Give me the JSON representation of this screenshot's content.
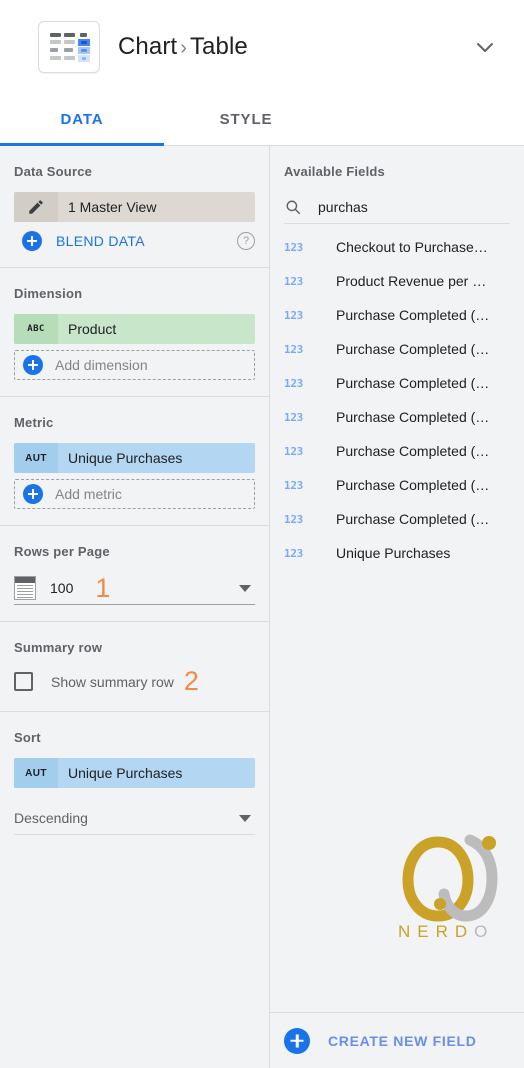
{
  "header": {
    "icon": "table-chart-icon",
    "title_prefix": "Chart",
    "separator": "›",
    "title_value": "Table",
    "collapse_icon": "chevron-down-icon"
  },
  "tabs": [
    {
      "label": "DATA",
      "active": true
    },
    {
      "label": "STYLE",
      "active": false
    }
  ],
  "panel": {
    "data_source": {
      "label": "Data Source",
      "edit_icon": "pencil-icon",
      "name": "1 Master View",
      "blend_label": "BLEND DATA",
      "blend_icon": "plus-circle-icon",
      "help_icon": "question-mark-icon",
      "help_glyph": "?"
    },
    "dimension": {
      "label": "Dimension",
      "chip_badge": "ABC",
      "chip_name": "Product",
      "add_label": "Add dimension"
    },
    "metric": {
      "label": "Metric",
      "chip_badge": "AUT",
      "chip_name": "Unique Purchases",
      "add_label": "Add metric"
    },
    "rows_per_page": {
      "label": "Rows per Page",
      "icon": "rows-icon",
      "value": "100",
      "annotation": "1",
      "dropdown_icon": "caret-down-icon"
    },
    "summary_row": {
      "label": "Summary row",
      "checkbox_label": "Show summary row",
      "checked": false,
      "annotation": "2"
    },
    "sort": {
      "label": "Sort",
      "chip_badge": "AUT",
      "chip_name": "Unique Purchases",
      "direction": "Descending",
      "dropdown_icon": "caret-down-icon"
    }
  },
  "fields": {
    "header": "Available Fields",
    "search_icon": "search-icon",
    "search_value": "purchas",
    "items": [
      {
        "type": "123",
        "name": "Checkout to Purchase…"
      },
      {
        "type": "123",
        "name": "Product Revenue per …"
      },
      {
        "type": "123",
        "name": "Purchase Completed (…"
      },
      {
        "type": "123",
        "name": "Purchase Completed (…"
      },
      {
        "type": "123",
        "name": "Purchase Completed (…"
      },
      {
        "type": "123",
        "name": "Purchase Completed (…"
      },
      {
        "type": "123",
        "name": "Purchase Completed (…"
      },
      {
        "type": "123",
        "name": "Purchase Completed (…"
      },
      {
        "type": "123",
        "name": "Purchase Completed (…"
      },
      {
        "type": "123",
        "name": "Unique Purchases"
      }
    ],
    "create_label": "CREATE NEW FIELD",
    "create_icon": "plus-circle-icon"
  },
  "watermark": {
    "name": "nerdo-logo",
    "wordmark_main": "NERD",
    "wordmark_last": "O"
  },
  "colors": {
    "accent_blue": "#1a73e8",
    "dimension_green": "#c8e6c9",
    "metric_blue": "#b3d7f2",
    "source_tan": "#ddd9d2",
    "annotation_orange": "#f28b44",
    "logo_gold": "#c9a227",
    "logo_silver": "#b9b9b9",
    "panel_bg": "#f1f3f4"
  }
}
